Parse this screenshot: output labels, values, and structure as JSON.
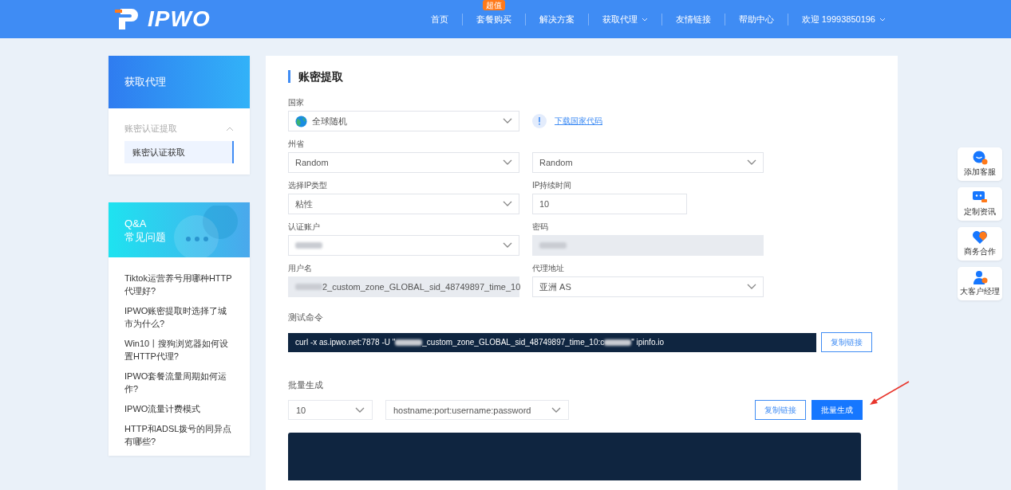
{
  "header": {
    "logo": "IPWO",
    "nav": [
      {
        "label": "首页",
        "dropdown": false
      },
      {
        "label": "套餐购买",
        "badge": "超值",
        "dropdown": false
      },
      {
        "label": "解决方案",
        "dropdown": false
      },
      {
        "label": "获取代理",
        "dropdown": true
      },
      {
        "label": "友情链接",
        "dropdown": false
      },
      {
        "label": "帮助中心",
        "dropdown": false
      }
    ],
    "user": {
      "label": "欢迎 19993850196",
      "dropdown": true
    }
  },
  "sidebar": {
    "proxy_card": {
      "title": "获取代理",
      "group": {
        "label": "账密认证提取",
        "expanded": true,
        "children": [
          {
            "label": "账密认证获取",
            "selected": true
          }
        ]
      }
    },
    "qa_card": {
      "title_lines": [
        "Q&A",
        "常见问题"
      ],
      "items": [
        "Tiktok运营养号用哪种HTTP代理好?",
        "IPWO账密提取时选择了城市为什么?",
        "Win10丨搜狗浏览器如何设置HTTP代理?",
        "IPWO套餐流量周期如何运作?",
        "IPWO流量计费模式",
        "HTTP和ADSL拨号的同异点有哪些?"
      ]
    }
  },
  "main": {
    "title": "账密提取",
    "rows": [
      [
        {
          "label": "国家",
          "kind": "select",
          "globe": true,
          "value_parts": [
            {
              "kind": "text",
              "text": "全球随机"
            }
          ]
        },
        {
          "kind": "link",
          "text": "下载国家代码"
        }
      ],
      [
        {
          "label": "州省",
          "kind": "select",
          "value_parts": [
            {
              "kind": "text",
              "text": "Random"
            }
          ]
        },
        {
          "kind": "select",
          "value_parts": [
            {
              "kind": "text",
              "text": "Random"
            }
          ]
        }
      ],
      [
        {
          "label": "选择IP类型",
          "kind": "select",
          "value_parts": [
            {
              "kind": "text",
              "text": "粘性"
            }
          ]
        },
        {
          "label": "IP持续时间",
          "kind": "input",
          "value_parts": [
            {
              "kind": "text",
              "text": "10"
            }
          ]
        }
      ],
      [
        {
          "label": "认证账户",
          "kind": "select",
          "value_parts": [
            {
              "kind": "blur"
            }
          ]
        },
        {
          "label": "密码",
          "kind": "readonly",
          "value_parts": [
            {
              "kind": "blur"
            }
          ]
        }
      ],
      [
        {
          "label": "用户名",
          "kind": "readonly",
          "value_parts": [
            {
              "kind": "blur"
            },
            {
              "kind": "text",
              "text": "2_custom_zone_GLOBAL_sid_48749897_time_10"
            }
          ]
        },
        {
          "label": "代理地址",
          "kind": "select",
          "value_parts": [
            {
              "kind": "text",
              "text": "亚洲 AS"
            }
          ]
        }
      ]
    ],
    "test_command": {
      "label": "测试命令",
      "parts": [
        {
          "kind": "text",
          "text": "curl -x as.ipwo.net:7878 -U \""
        },
        {
          "kind": "blur"
        },
        {
          "kind": "text",
          "text": "_custom_zone_GLOBAL_sid_48749897_time_10:c"
        },
        {
          "kind": "blur"
        },
        {
          "kind": "text",
          "text": "\" ipinfo.io"
        }
      ],
      "button": "复制链接"
    },
    "batch": {
      "label": "批量生成",
      "count": "10",
      "format": "hostname:port:username:password",
      "buttons": [
        {
          "label": "复制链接",
          "kind": "outline"
        },
        {
          "label": "批量生成",
          "kind": "primary"
        }
      ]
    }
  },
  "float_buttons": [
    {
      "label": "添加客服",
      "kind": "service"
    },
    {
      "label": "定制资讯",
      "kind": "chat"
    },
    {
      "label": "商务合作",
      "kind": "handshake"
    },
    {
      "label": "大客户经理",
      "kind": "manager"
    }
  ]
}
